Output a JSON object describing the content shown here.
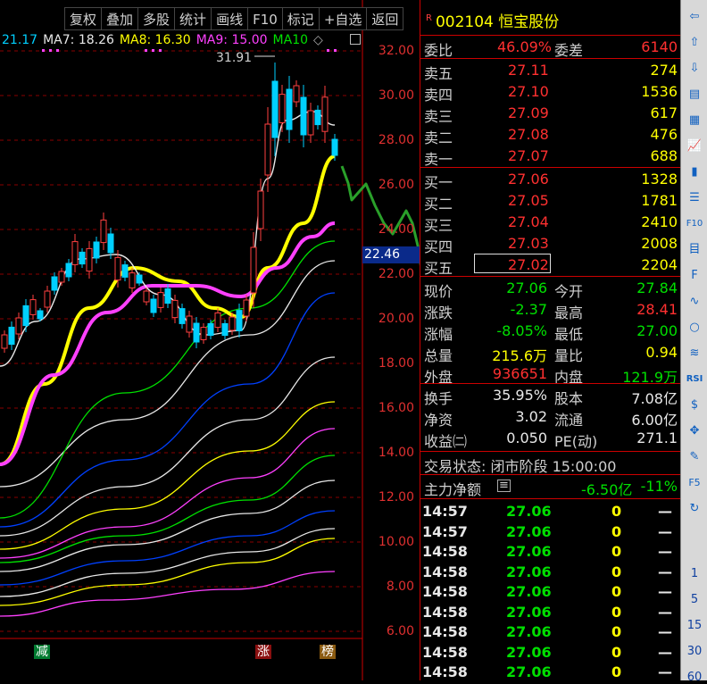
{
  "toolbar": [
    "复权",
    "叠加",
    "多股",
    "统计",
    "画线",
    "F10",
    "标记",
    "+自选",
    "返回"
  ],
  "ma_legend": [
    {
      "label": "21.17",
      "color": "#00d0ff"
    },
    {
      "label": "MA7: 18.26",
      "color": "#e8e8e8"
    },
    {
      "label": "MA8: 16.30",
      "color": "#ffff00"
    },
    {
      "label": "MA9: 15.00",
      "color": "#ff40ff"
    },
    {
      "label": "MA10",
      "color": "#00e000"
    }
  ],
  "chart_data": {
    "type": "candlestick",
    "yticks": [
      "32.00",
      "30.00",
      "28.00",
      "26.00",
      "24.00",
      "22.00",
      "20.00",
      "18.00",
      "16.00",
      "14.00",
      "12.00",
      "10.00",
      "8.00",
      "6.00"
    ],
    "ylim": [
      5,
      33
    ],
    "peak_label": "31.91",
    "cursor_price": "22.46",
    "tags": [
      "减",
      "涨",
      "榜"
    ]
  },
  "stock": {
    "code": "002104",
    "name": "恒宝股份",
    "r_mark": "R"
  },
  "weibi": {
    "label1": "委比",
    "val1": "46.09%",
    "label2": "委差",
    "val2": "6140"
  },
  "asks": [
    {
      "label": "卖五",
      "price": "27.11",
      "vol": "274"
    },
    {
      "label": "卖四",
      "price": "27.10",
      "vol": "1536"
    },
    {
      "label": "卖三",
      "price": "27.09",
      "vol": "617"
    },
    {
      "label": "卖二",
      "price": "27.08",
      "vol": "476"
    },
    {
      "label": "卖一",
      "price": "27.07",
      "vol": "688"
    }
  ],
  "bids": [
    {
      "label": "买一",
      "price": "27.06",
      "vol": "1328"
    },
    {
      "label": "买二",
      "price": "27.05",
      "vol": "1781"
    },
    {
      "label": "买三",
      "price": "27.04",
      "vol": "2410"
    },
    {
      "label": "买四",
      "price": "27.03",
      "vol": "2008"
    },
    {
      "label": "买五",
      "price": "27.02",
      "vol": "2204"
    }
  ],
  "quote": [
    {
      "l1": "现价",
      "v1": "27.06",
      "l2": "今开",
      "v2": "27.84"
    },
    {
      "l1": "涨跌",
      "v1": "-2.37",
      "l2": "最高",
      "v2": "28.41"
    },
    {
      "l1": "涨幅",
      "v1": "-8.05%",
      "l2": "最低",
      "v2": "27.00"
    },
    {
      "l1": "总量",
      "v1": "215.6万",
      "l2": "量比",
      "v2": "0.94"
    },
    {
      "l1": "外盘",
      "v1": "936651",
      "l2": "内盘",
      "v2": "121.9万"
    }
  ],
  "stats": [
    {
      "l1": "换手",
      "v1": "35.95%",
      "l2": "股本",
      "v2": "7.08亿"
    },
    {
      "l1": "净资",
      "v1": "3.02",
      "l2": "流通",
      "v2": "6.00亿"
    },
    {
      "l1": "收益㈡",
      "v1": "0.050",
      "l2": "PE(动)",
      "v2": "271.1"
    }
  ],
  "trade_status": "交易状态: 闭市阶段 15:00:00",
  "main_flow": {
    "label": "主力净额",
    "value": "-6.50亿",
    "pct": "-11%"
  },
  "ticks": [
    {
      "time": "14:57",
      "price": "27.06",
      "vol": "0",
      "dir": "—"
    },
    {
      "time": "14:57",
      "price": "27.06",
      "vol": "0",
      "dir": "—"
    },
    {
      "time": "14:58",
      "price": "27.06",
      "vol": "0",
      "dir": "—"
    },
    {
      "time": "14:58",
      "price": "27.06",
      "vol": "0",
      "dir": "—"
    },
    {
      "time": "14:58",
      "price": "27.06",
      "vol": "0",
      "dir": "—"
    },
    {
      "time": "14:58",
      "price": "27.06",
      "vol": "0",
      "dir": "—"
    },
    {
      "time": "14:58",
      "price": "27.06",
      "vol": "0",
      "dir": "—"
    },
    {
      "time": "14:58",
      "price": "27.06",
      "vol": "0",
      "dir": "—"
    },
    {
      "time": "14:58",
      "price": "27.06",
      "vol": "0",
      "dir": "—"
    }
  ],
  "iconbar": {
    "icons": [
      "arrow-left-icon",
      "arrow-up-icon",
      "arrow-down-icon",
      "table-icon",
      "grid-icon",
      "line-chart-icon",
      "candle-icon",
      "list-icon",
      "f10-icon",
      "report-icon",
      "f2-icon",
      "trend-icon",
      "circle-icon",
      "wave-icon",
      "rsi-icon",
      "s-icon",
      "move-icon",
      "pencil-icon",
      "f5-icon",
      "refresh-icon"
    ],
    "labels": {
      "f10": "F10",
      "rsi": "RSI",
      "f5": "F5"
    },
    "periods": [
      "1",
      "5",
      "15",
      "30",
      "60"
    ]
  }
}
